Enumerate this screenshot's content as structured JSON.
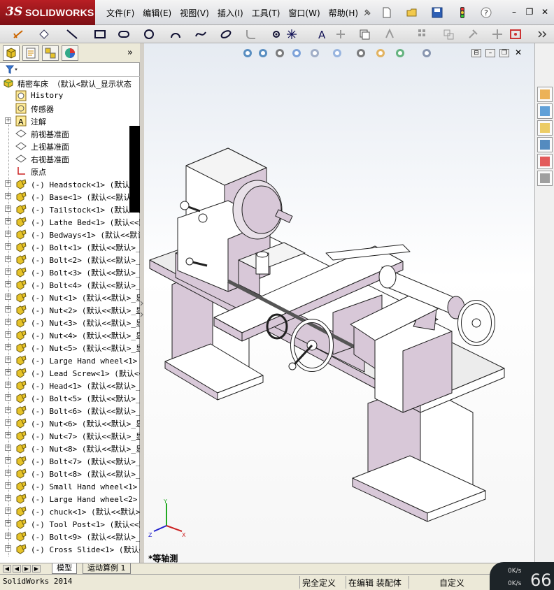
{
  "app": {
    "logo_ds": "3S",
    "logo_text": "SOLIDWORKS"
  },
  "menu": {
    "items": [
      {
        "label": "文件(F)"
      },
      {
        "label": "编辑(E)"
      },
      {
        "label": "视图(V)"
      },
      {
        "label": "插入(I)"
      },
      {
        "label": "工具(T)"
      },
      {
        "label": "窗口(W)"
      },
      {
        "label": "帮助(H)"
      }
    ]
  },
  "title_icons": [
    "pin-icon",
    "new-document-icon",
    "open-folder-icon",
    "save-icon",
    "traffic-light-icon",
    "help-icon"
  ],
  "window_controls": {
    "help": "?",
    "minimize": "–",
    "restore": "❐",
    "close": "✕"
  },
  "sketch_toolbar_icons": [
    "smart-dimension-icon",
    "relation-icon",
    "line-icon",
    "rectangle-icon",
    "slot-icon",
    "circle-icon",
    "arc-icon",
    "spline-icon",
    "ellipse-icon",
    "fillet-icon",
    "point-icon",
    "centerline-icon",
    "text-icon",
    "trim-icon",
    "offset-icon",
    "mirror-icon",
    "pattern-icon",
    "move-icon",
    "repair-icon",
    "quick-snap-icon",
    "rapid-sketch-icon"
  ],
  "pane_tabs": [
    "feature-manager-icon",
    "property-manager-icon",
    "configuration-manager-icon",
    "display-manager-icon"
  ],
  "tree": {
    "root": "精密车床 （默认<默认_显示状态",
    "items": [
      {
        "label": "History",
        "icon": "history-icon",
        "expand": false
      },
      {
        "label": "传感器",
        "icon": "sensor-icon",
        "expand": false
      },
      {
        "label": "注解",
        "icon": "annotation-icon",
        "expand": true
      },
      {
        "label": "前视基准面",
        "icon": "plane-icon",
        "expand": false
      },
      {
        "label": "上视基准面",
        "icon": "plane-icon",
        "expand": false
      },
      {
        "label": "右视基准面",
        "icon": "plane-icon",
        "expand": false
      },
      {
        "label": "原点",
        "icon": "origin-icon",
        "expand": false
      },
      {
        "label": "(-) Headstock<1> (默认<<默认",
        "icon": "part-icon",
        "expand": true
      },
      {
        "label": "(-) Base<1> (默认<<默认>_显",
        "icon": "part-icon",
        "expand": true
      },
      {
        "label": "(-) Tailstock<1> (默认<<默",
        "icon": "part-icon",
        "expand": true
      },
      {
        "label": "(-) Lathe Bed<1> (默认<<默",
        "icon": "part-icon",
        "expand": true
      },
      {
        "label": "(-) Bedways<1> (默认<<默认",
        "icon": "part-icon",
        "expand": true
      },
      {
        "label": "(-) Bolt<1> (默认<<默认>_显",
        "icon": "part-icon",
        "expand": true
      },
      {
        "label": "(-) Bolt<2> (默认<<默认>_显",
        "icon": "part-icon",
        "expand": true
      },
      {
        "label": "(-) Bolt<3> (默认<<默认>_显",
        "icon": "part-icon",
        "expand": true
      },
      {
        "label": "(-) Bolt<4> (默认<<默认>_显",
        "icon": "part-icon",
        "expand": true
      },
      {
        "label": "(-) Nut<1> (默认<<默认>_显",
        "icon": "part-icon",
        "expand": true
      },
      {
        "label": "(-) Nut<2> (默认<<默认>_显",
        "icon": "part-icon",
        "expand": true
      },
      {
        "label": "(-) Nut<3> (默认<<默认>_显",
        "icon": "part-icon",
        "expand": true
      },
      {
        "label": "(-) Nut<4> (默认<<默认>_显",
        "icon": "part-icon",
        "expand": true
      },
      {
        "label": "(-) Nut<5> (默认<<默认>_显",
        "icon": "part-icon",
        "expand": true
      },
      {
        "label": "(-) Large Hand wheel<1> (默",
        "icon": "part-icon",
        "expand": true
      },
      {
        "label": "(-) Lead Screw<1> (默认<<默",
        "icon": "part-icon",
        "expand": true
      },
      {
        "label": "(-) Head<1> (默认<<默认>_显",
        "icon": "part-icon",
        "expand": true
      },
      {
        "label": "(-) Bolt<5> (默认<<默认>_显",
        "icon": "part-icon",
        "expand": true
      },
      {
        "label": "(-) Bolt<6> (默认<<默认>_显",
        "icon": "part-icon",
        "expand": true
      },
      {
        "label": "(-) Nut<6> (默认<<默认>_显",
        "icon": "part-icon",
        "expand": true
      },
      {
        "label": "(-) Nut<7> (默认<<默认>_显",
        "icon": "part-icon",
        "expand": true
      },
      {
        "label": "(-) Nut<8> (默认<<默认>_显",
        "icon": "part-icon",
        "expand": true
      },
      {
        "label": "(-) Bolt<7> (默认<<默认>_显",
        "icon": "part-icon",
        "expand": true
      },
      {
        "label": "(-) Bolt<8> (默认<<默认>_显",
        "icon": "part-icon",
        "expand": true
      },
      {
        "label": "(-) Small Hand wheel<1> (默",
        "icon": "part-icon",
        "expand": true
      },
      {
        "label": "(-) Large Hand wheel<2> (默",
        "icon": "part-icon",
        "expand": true
      },
      {
        "label": "(-) chuck<1> (默认<<默认>_",
        "icon": "part-icon",
        "expand": true
      },
      {
        "label": "(-) Tool Post<1> (默认<<默",
        "icon": "part-icon",
        "expand": true
      },
      {
        "label": "(-) Bolt<9> (默认<<默认>_显",
        "icon": "part-icon",
        "expand": true
      },
      {
        "label": "(-) Cross Slide<1> (默认<<",
        "icon": "part-icon",
        "expand": true
      }
    ]
  },
  "bottom_tabs": [
    {
      "label": "模型"
    },
    {
      "label": "运动算例 1"
    }
  ],
  "status": {
    "app_version": "SolidWorks 2014",
    "definition": "完全定义",
    "mode": "在编辑 装配体",
    "units": "自定义",
    "net_up": "0K/s",
    "net_down": "0K/s",
    "net_percent": "66"
  },
  "viewport": {
    "view_name": "*等轴测",
    "triad": {
      "x": "X",
      "y": "Y",
      "z": "Z"
    },
    "heads_up_icons": [
      "zoom-to-fit-icon",
      "zoom-area-icon",
      "previous-view-icon",
      "section-view-icon",
      "view-orientation-icon",
      "display-style-icon",
      "hide-show-icon",
      "edit-appearance-icon",
      "apply-scene-icon",
      "view-settings-icon"
    ]
  },
  "task_pane_icons": [
    "resources-icon",
    "design-library-icon",
    "file-explorer-icon",
    "view-palette-icon",
    "appearances-icon",
    "custom-properties-icon"
  ],
  "colors": {
    "brand_red": "#b81f24",
    "model_face": "#ffffff",
    "model_side": "#d8c8d8",
    "model_edge": "#202020"
  }
}
